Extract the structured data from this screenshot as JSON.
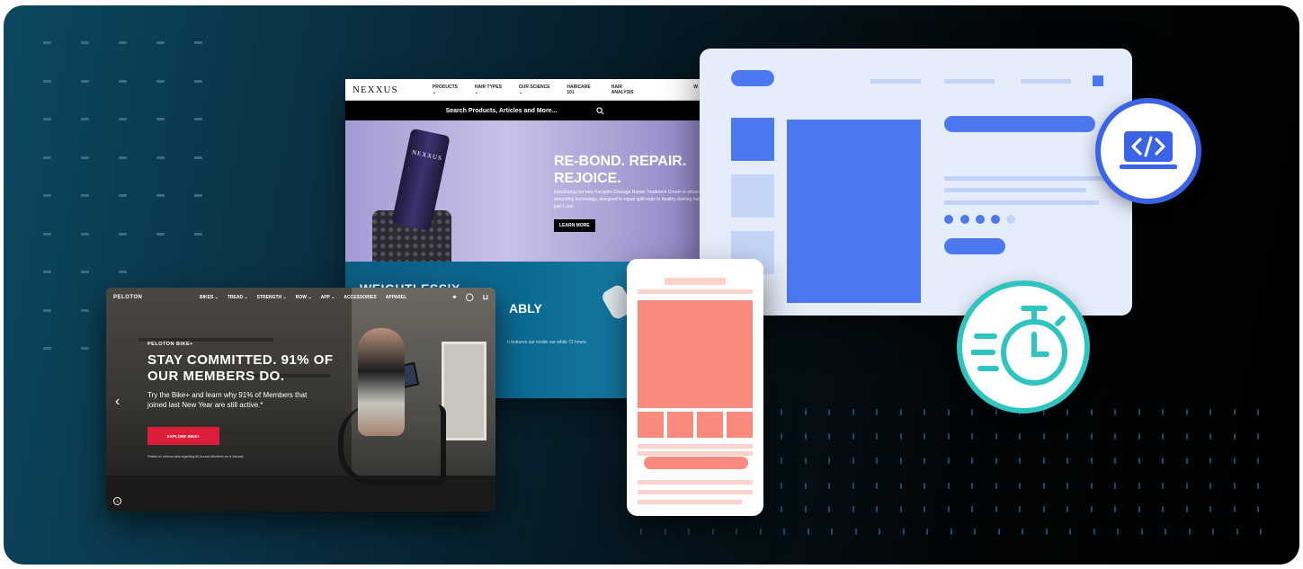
{
  "nexxus": {
    "logo": "NEXXUS",
    "nav": [
      "PRODUCTS ⌄",
      "HAIR TYPES ⌄",
      "OUR SCIENCE ⌄",
      "HAIRCARE 101",
      "HAIR ANALYSIS"
    ],
    "nav_extra": "W",
    "search_placeholder": "Search Products, Articles and More...",
    "bottle_label": "NEXXUS",
    "hero_headline": "RE-BOND. REPAIR. REJOICE.",
    "hero_body": "Introducing our new Keraphix Damage Repair Treatment Cream w advanced rebonding technology, designed to repair split ends fo healthy-looking hair in just 1 use.",
    "hero_button": "LEARN MORE",
    "section2_text_left": "WEIGHTLESS|X",
    "section2_text_right": "ABLY",
    "section2_small": "n features our inside our while 72 hours."
  },
  "peloton": {
    "logo": "PELOTON",
    "nav": [
      "BIKES ⌄",
      "TREAD ⌄",
      "STRENGTH ⌄",
      "ROW ⌄",
      "APP ⌄",
      "ACCESSORIES",
      "APPAREL"
    ],
    "eyebrow": "PELOTON BIKE+",
    "headline": "STAY COMMITTED. 91% OF OUR MEMBERS DO.",
    "subtext": "Try the Bike+ and learn why 91% of Members that joined last New Year are still active.*",
    "cta": "EXPLORE BIKE+",
    "fineprint": "*Based on internal data regarding All-Access Members as of January",
    "prev_arrow": "‹",
    "pause": "II"
  },
  "code_badge_icon": "code-laptop-icon",
  "timer_badge_icon": "stopwatch-icon",
  "colors": {
    "wire_blue": "#4c78f0",
    "wire_light_blue": "#c5d5f8",
    "wire_coral": "#fa8a7d",
    "wire_light_coral": "#fcd2cc",
    "teal": "#2fc4c0"
  }
}
